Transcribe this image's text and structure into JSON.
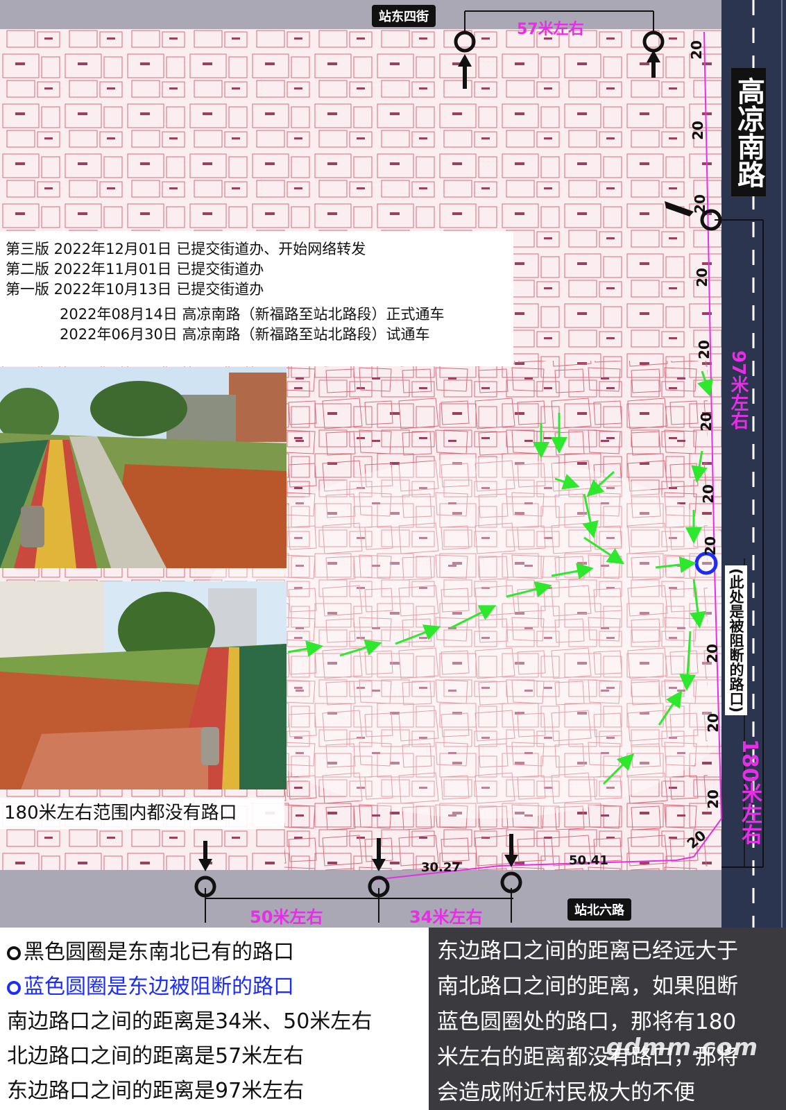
{
  "streets": {
    "north": "站东四街",
    "south": "站北六路",
    "east_road": "高凉南路"
  },
  "distances": {
    "north": "57米左右",
    "east_upper": "97米左右",
    "east_lower": "180米左右",
    "south_left": "50米左右",
    "south_right": "34米左右",
    "measure_a": "30.27",
    "measure_b": "50.41",
    "speed": "20"
  },
  "blocked_note": "(此处是被阻断的路口)",
  "versions": [
    "第三版 2022年12月01日 已提交街道办、开始网络转发",
    "第二版 2022年11月01日 已提交街道办",
    "第一版 2022年10月13日 已提交街道办",
    "2022年08月14日 高凉南路（新福路至站北路段）正式通车",
    "2022年06月30日 高凉南路（新福路至站北路段）试通车"
  ],
  "photo_caption": "180米左右范围内都没有路口",
  "legend_left": [
    "黑色圆圈是东南北已有的路口",
    "蓝色圆圈是东边被阻断的路口",
    "南边路口之间的距离是34米、50米左右",
    "北边路口之间的距离是57米左右",
    "东边路口之间的距离是97米左右"
  ],
  "legend_right": [
    "东边路口之间的距离已经远大于",
    "南北路口之间的距离，如果阻断",
    "蓝色圆圈处的路口，那将有180",
    "米左右的距离都没有路口，那将",
    "会造成附近村民极大的不便"
  ],
  "watermark": "gdmm.com",
  "colors": {
    "magenta": "#e62ee6",
    "blue_circle": "#1a2cff",
    "arrow_green": "#2ee82e",
    "road_dark": "#2c3550",
    "map_bg": "#fbeef0",
    "building_line": "#d66a7c"
  },
  "icons": [
    "black-circle-icon",
    "blue-circle-icon",
    "down-arrow-icon",
    "up-arrow-icon",
    "green-arrow-icon"
  ]
}
